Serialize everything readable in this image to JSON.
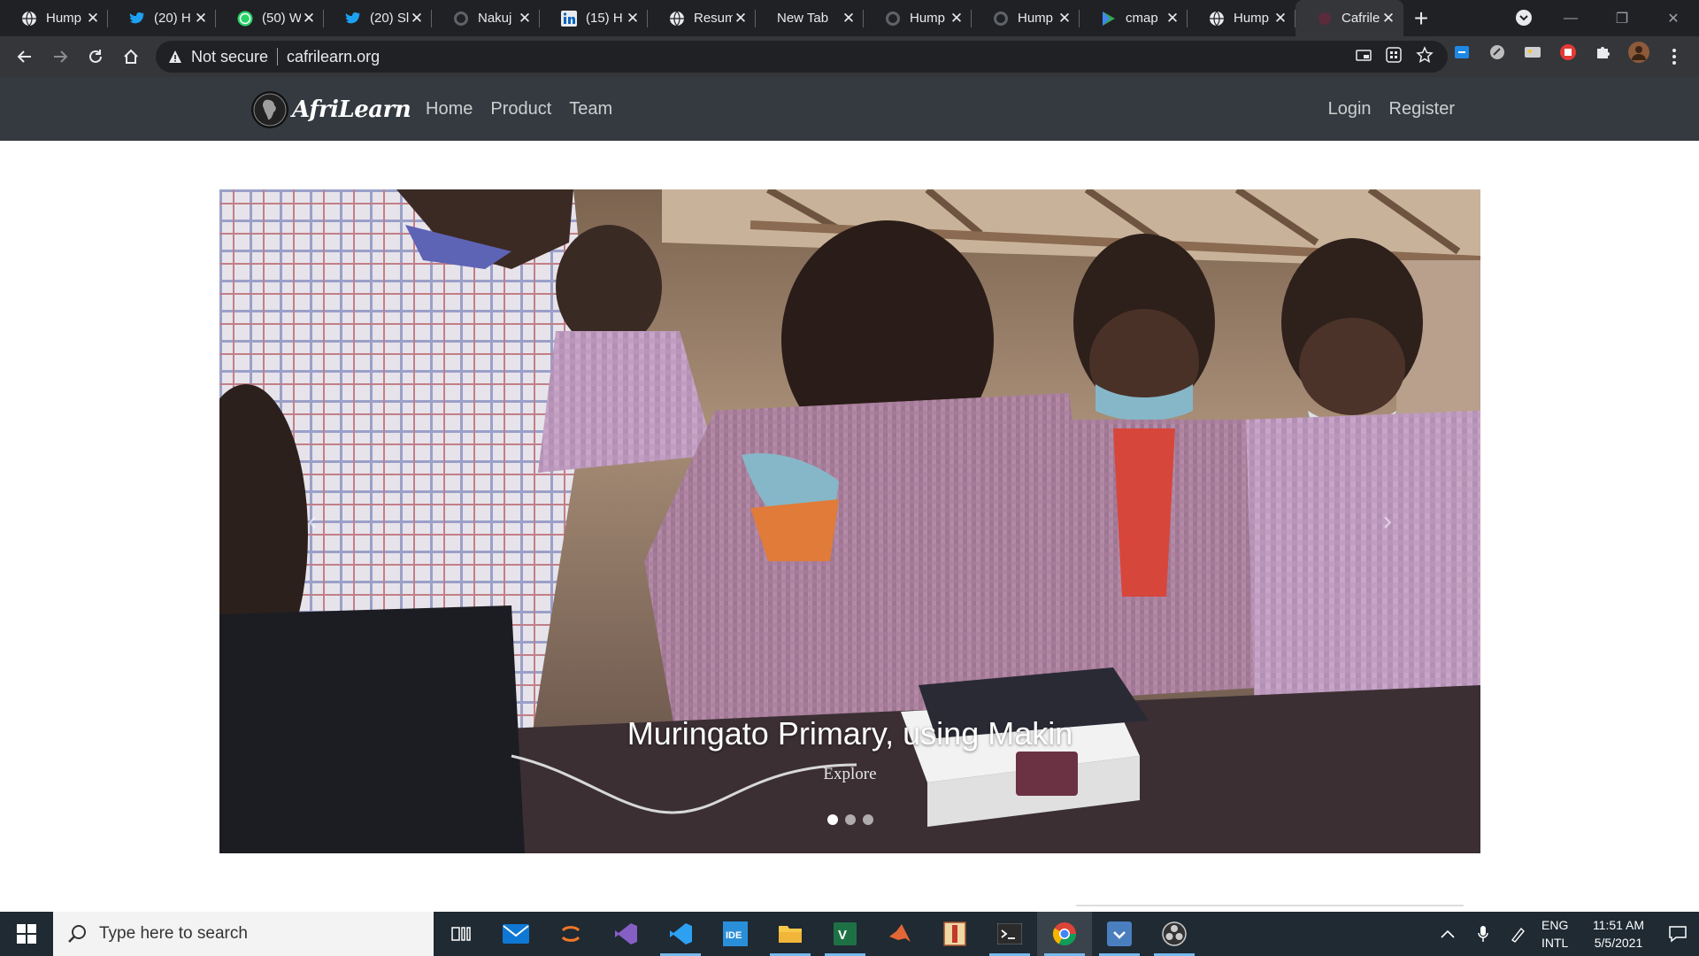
{
  "browser": {
    "tabs": [
      {
        "title": "Hump",
        "icon": "globe-icon"
      },
      {
        "title": "(20) H",
        "icon": "twitter-icon"
      },
      {
        "title": "(50) W",
        "icon": "whatsapp-icon"
      },
      {
        "title": "(20) Sl",
        "icon": "twitter-icon"
      },
      {
        "title": "Nakuj",
        "icon": "github-icon"
      },
      {
        "title": "(15) H",
        "icon": "linkedin-icon"
      },
      {
        "title": "Resum",
        "icon": "globe-icon"
      },
      {
        "title": "New Tab",
        "icon": ""
      },
      {
        "title": "Hump",
        "icon": "github-icon"
      },
      {
        "title": "Hump",
        "icon": "github-icon"
      },
      {
        "title": "cmap",
        "icon": "play-icon"
      },
      {
        "title": "Hump",
        "icon": "globe-icon"
      },
      {
        "title": "Cafrile",
        "icon": "site-icon"
      }
    ],
    "active_tab_index": 12,
    "security_label": "Not secure",
    "url": "cafrilearn.org"
  },
  "site": {
    "brand": "AfriLearn",
    "nav": [
      "Home",
      "Product",
      "Team"
    ],
    "auth": {
      "login": "Login",
      "register": "Register"
    }
  },
  "carousel": {
    "caption": "Muringato Primary, using Makin",
    "button": "Explore",
    "slides": 3,
    "active_slide": 0,
    "prev_glyph": "‹",
    "next_glyph": "›"
  },
  "taskbar": {
    "search_placeholder": "Type here to search",
    "apps": [
      "task-view-icon",
      "mail-icon",
      "jupyter-icon",
      "visual-studio-icon",
      "vscode-icon",
      "intellij-icon",
      "file-explorer-icon",
      "excel-icon",
      "matlab-icon",
      "archive-icon",
      "terminal-icon",
      "chrome-icon",
      "download-icon",
      "obs-icon"
    ],
    "language_line1": "ENG",
    "language_line2": "INTL",
    "time": "11:51 AM",
    "date": "5/5/2021"
  }
}
